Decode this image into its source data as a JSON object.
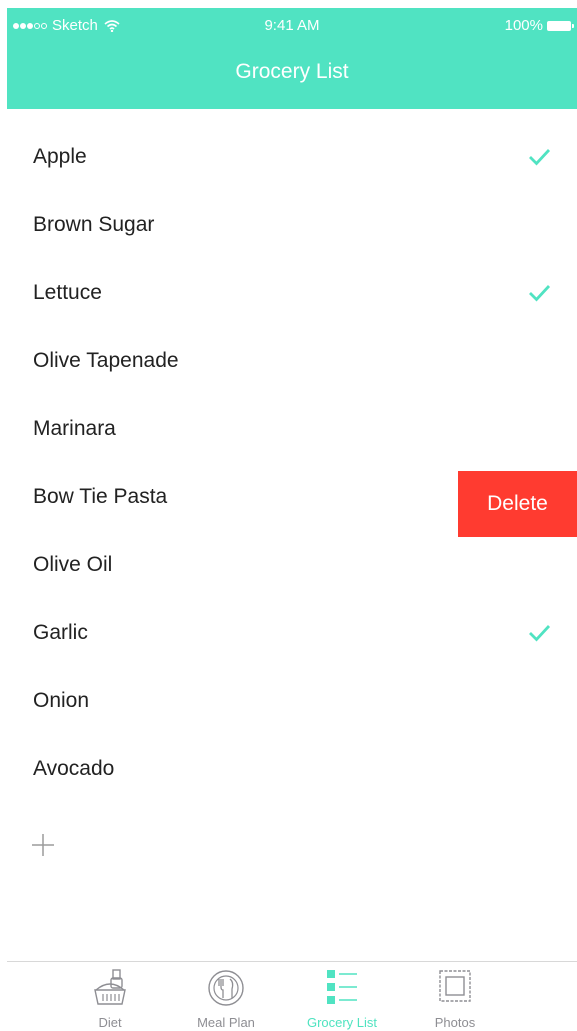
{
  "colors": {
    "accent": "#50E3C2",
    "delete": "#FF3B30",
    "inactive": "#8E8E93"
  },
  "status_bar": {
    "carrier": "Sketch",
    "time": "9:41 AM",
    "battery": "100%"
  },
  "nav": {
    "title": "Grocery List"
  },
  "items": [
    {
      "label": "Apple",
      "checked": true
    },
    {
      "label": "Brown Sugar",
      "checked": false
    },
    {
      "label": "Lettuce",
      "checked": true
    },
    {
      "label": "Olive Tapenade",
      "checked": false
    },
    {
      "label": "Marinara",
      "checked": false
    },
    {
      "label": "Bow Tie Pasta",
      "checked": false,
      "swiped": true
    },
    {
      "label": "Olive Oil",
      "checked": false
    },
    {
      "label": "Garlic",
      "checked": true
    },
    {
      "label": "Onion",
      "checked": false
    },
    {
      "label": "Avocado",
      "checked": false
    }
  ],
  "delete_label": "Delete",
  "tabs": [
    {
      "label": "Diet",
      "icon": "basket-icon",
      "active": false
    },
    {
      "label": "Meal Plan",
      "icon": "plate-utensils-icon",
      "active": false
    },
    {
      "label": "Grocery List",
      "icon": "checklist-icon",
      "active": true
    },
    {
      "label": "Photos",
      "icon": "photo-frame-icon",
      "active": false
    }
  ]
}
